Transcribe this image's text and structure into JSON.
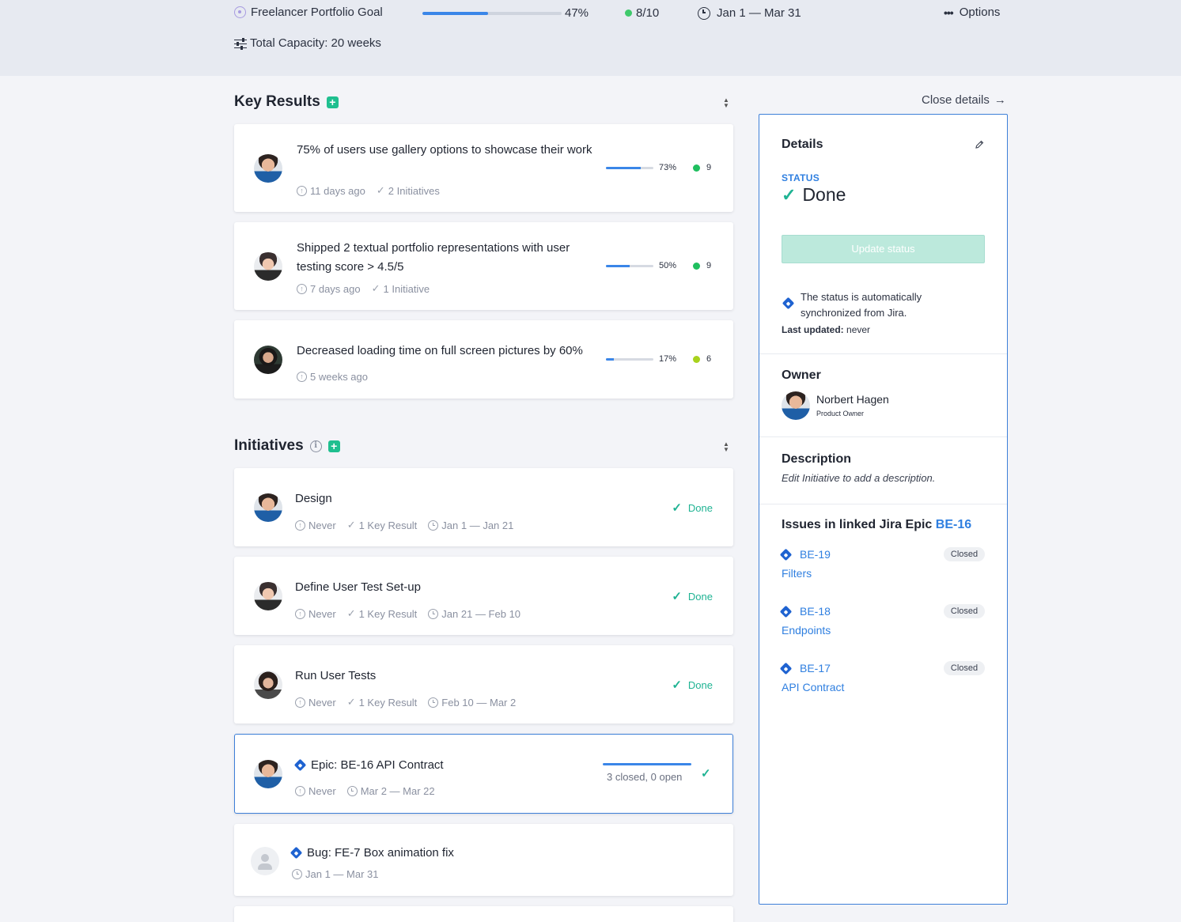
{
  "header": {
    "goal_title": "Freelancer Portfolio Goal",
    "progress_fraction": 0.47,
    "progress_text": "47%",
    "score": "8/10",
    "score_color": "#3fc96b",
    "dates": "Jan 1 — Mar 31",
    "options_label": "Options",
    "capacity": "Total Capacity: 20 weeks"
  },
  "key_results": {
    "title": "Key Results",
    "items": [
      {
        "title": "75% of users use gallery options to showcase their work",
        "updated": "11 days ago",
        "initiatives": "2 Initiatives",
        "progress_fraction": 0.73,
        "progress_text": "73%",
        "score": "9",
        "score_color": "#1fbf5f"
      },
      {
        "title": "Shipped 2 textual portfolio representations with user testing score > 4.5/5",
        "updated": "7 days ago",
        "initiatives": "1 Initiative",
        "progress_fraction": 0.5,
        "progress_text": "50%",
        "score": "9",
        "score_color": "#1fbf5f"
      },
      {
        "title": "Decreased loading time on full screen pictures by 60%",
        "updated": "5 weeks ago",
        "initiatives": "",
        "progress_fraction": 0.17,
        "progress_text": "17%",
        "score": "6",
        "score_color": "#a8d21d"
      }
    ]
  },
  "initiatives": {
    "title": "Initiatives",
    "items": [
      {
        "title": "Design",
        "updated": "Never",
        "key_results": "1 Key Result",
        "dates": "Jan 1 — Jan 21",
        "status": "Done"
      },
      {
        "title": "Define User Test Set-up",
        "updated": "Never",
        "key_results": "1 Key Result",
        "dates": "Jan 21 — Feb 10",
        "status": "Done"
      },
      {
        "title": "Run User Tests",
        "updated": "Never",
        "key_results": "1 Key Result",
        "dates": "Feb 10 — Mar 2",
        "status": "Done"
      },
      {
        "title": "Epic: BE-16 API Contract",
        "updated": "Never",
        "dates": "Mar 2 — Mar 22",
        "issues_summary": "3 closed, 0 open"
      },
      {
        "title": "Bug: FE-7 Box animation fix",
        "dates": "Jan 1 — Mar 31"
      }
    ]
  },
  "details": {
    "close_label": "Close details",
    "title": "Details",
    "status_label": "STATUS",
    "status_value": "Done",
    "update_button": "Update status",
    "sync_text": "The status is automatically synchronized from Jira.",
    "last_updated_label": "Last updated:",
    "last_updated_value": "never",
    "owner_heading": "Owner",
    "owner_name": "Norbert Hagen",
    "owner_role": "Product Owner",
    "description_heading": "Description",
    "description_text": "Edit Initiative to add a description.",
    "issues_heading": "Issues in linked Jira Epic",
    "issues_epic": "BE-16",
    "issues": [
      {
        "key": "BE-19",
        "name": "Filters",
        "status": "Closed"
      },
      {
        "key": "BE-18",
        "name": "Endpoints",
        "status": "Closed"
      },
      {
        "key": "BE-17",
        "name": "API Contract",
        "status": "Closed"
      }
    ]
  },
  "colors": {
    "accent_blue": "#3a86e8",
    "done_green": "#1fb393",
    "add_green": "#1fbf8f"
  }
}
